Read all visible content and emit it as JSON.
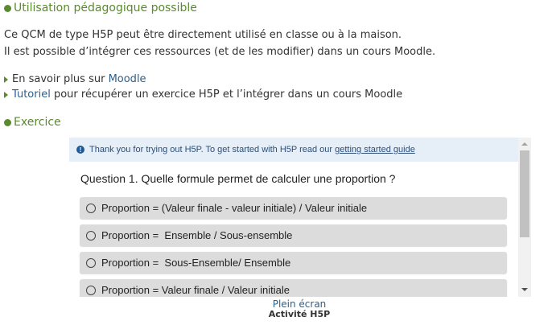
{
  "sections": {
    "usage_heading": "Utilisation pédagogique possible",
    "exercise_heading": "Exercice"
  },
  "paragraph": {
    "line1": "Ce QCM de type H5P peut être directement utilisé en classe ou à la maison.",
    "line2": "Il est possible d’intégrer ces ressources (et de les modifier) dans un cours Moodle."
  },
  "links": {
    "item1_prefix": "En savoir plus sur ",
    "item1_link": "Moodle",
    "item2_link": "Tutoriel",
    "item2_suffix": " pour récupérer un exercice H5P et l’intégrer dans un cours Moodle"
  },
  "h5p": {
    "banner_text": "Thank you for trying out H5P. To get started with H5P read our ",
    "banner_link": "getting started guide",
    "question": "Question 1. Quelle formule permet de calculer une proportion ?",
    "answers": [
      "Proportion = (Valeur finale - valeur initiale) / Valeur initiale",
      "Proportion =  Ensemble / Sous-ensemble",
      "Proportion =  Sous-Ensemble/ Ensemble",
      "Proportion = Valeur finale / Valeur initiale"
    ]
  },
  "footer": {
    "fullscreen": "Plein écran",
    "caption": "Activité H5P"
  },
  "colors": {
    "heading_green": "#5a8a2e",
    "link_blue": "#2c5f8a",
    "banner_bg": "#e6eef8",
    "answer_bg": "#dcdcdc"
  }
}
